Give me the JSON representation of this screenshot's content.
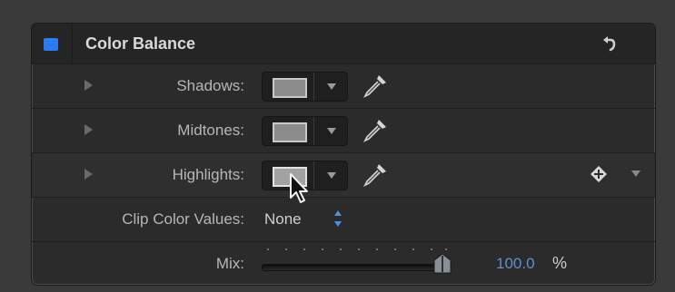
{
  "panel": {
    "title": "Color Balance",
    "enabled": true,
    "accent_color": "#2b7cf0"
  },
  "rows": [
    {
      "label": "Shadows:"
    },
    {
      "label": "Midtones:"
    },
    {
      "label": "Highlights:"
    }
  ],
  "clip": {
    "label": "Clip Color Values:",
    "value": "None"
  },
  "mix": {
    "label": "Mix:",
    "value": "100.0",
    "unit": "%",
    "level": 1.0,
    "value_color": "#5b8fd6"
  },
  "icons": [
    "reset-icon",
    "disclosure-triangle",
    "eyedropper-icon",
    "keyframe-add-icon",
    "popup-arrows-icon",
    "mouse-cursor"
  ]
}
